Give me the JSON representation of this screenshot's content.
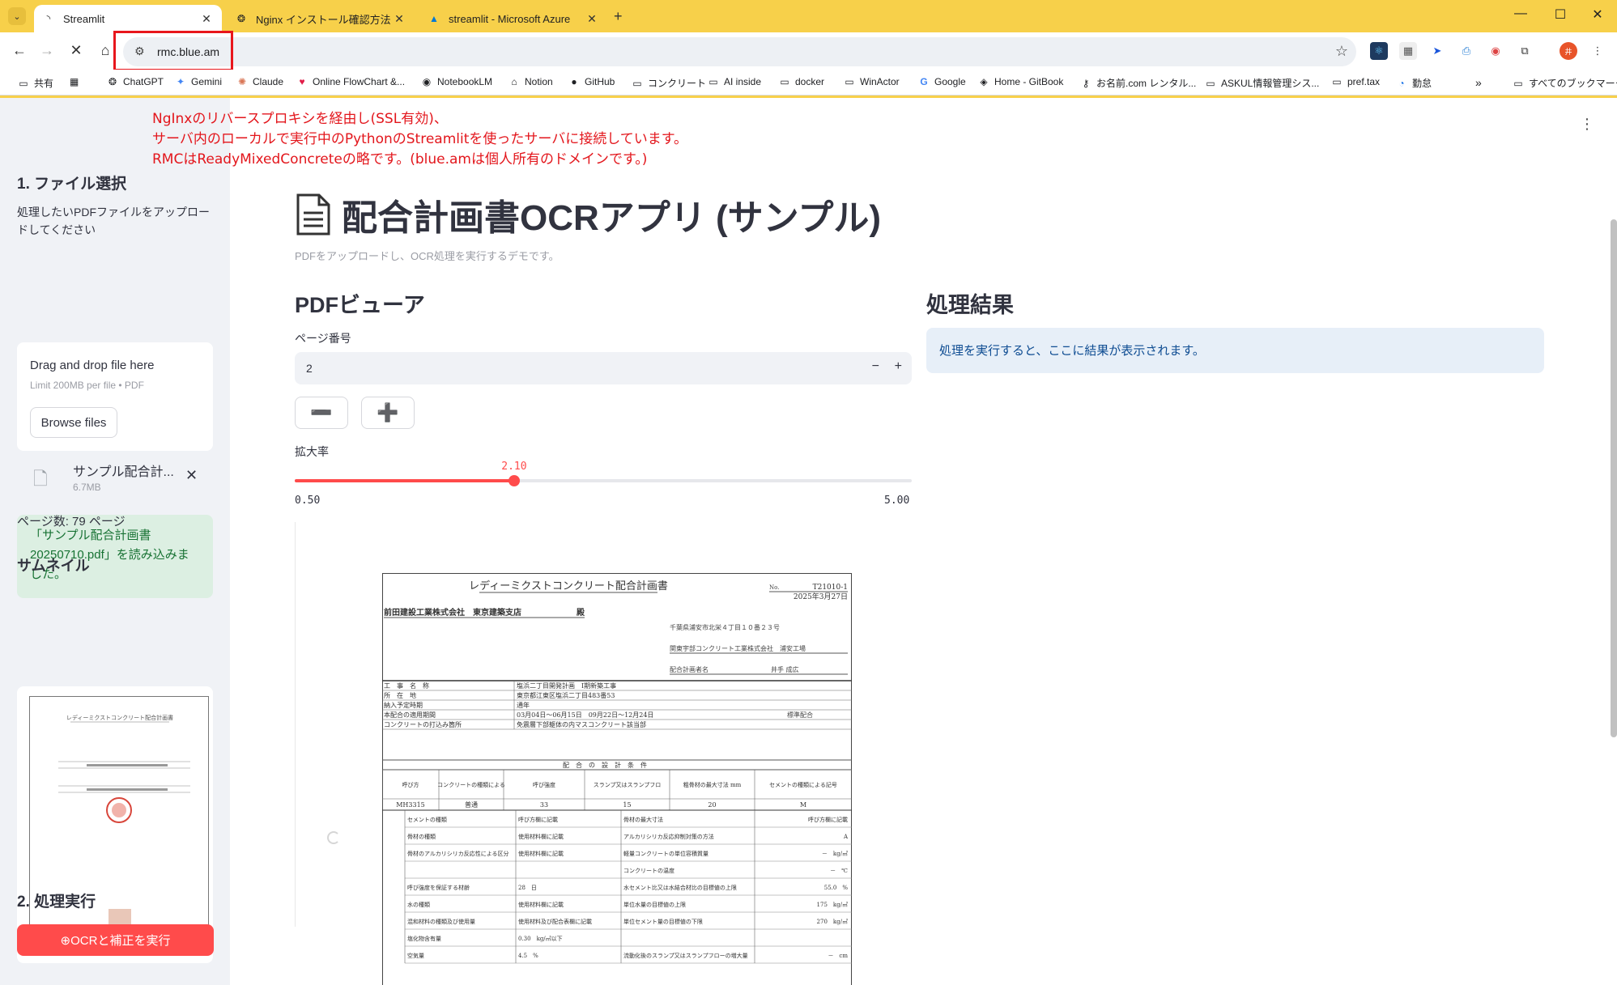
{
  "browser": {
    "tabs": [
      {
        "title": "Streamlit",
        "active": true
      },
      {
        "title": "Nginx インストール確認方法",
        "active": false
      },
      {
        "title": "streamlit - Microsoft Azure",
        "active": false
      }
    ],
    "url": "rmc.blue.am",
    "bookmarks": [
      "共有",
      "ChatGPT",
      "Gemini",
      "Claude",
      "Online FlowChart &...",
      "NotebookLM",
      "Notion",
      "GitHub",
      "コンクリート",
      "AI inside",
      "docker",
      "WinActor",
      "Google",
      "Home - GitBook",
      "お名前.com レンタル...",
      "ASKUL情報管理シス...",
      "pref.tax",
      "勤怠"
    ],
    "all_bookmarks": "すべてのブックマーク",
    "more": "»"
  },
  "annotation": [
    "NgInxのリバースプロキシを経由し(SSL有効)、",
    "サーバ内のローカルで実行中のPythonのStreamlitを使ったサーバに接続しています。",
    "RMCはReadyMixedConcreteの略です。(blue.amは個人所有のドメインです。)"
  ],
  "sidebar": {
    "section1_title": "1. ファイル選択",
    "upload_label": "処理したいPDFファイルをアップロードしてください",
    "dropzone_title": "Drag and drop file here",
    "dropzone_limit": "Limit 200MB per file • PDF",
    "browse_label": "Browse files",
    "file_name": "サンプル配合計...",
    "file_size": "6.7MB",
    "success_text": "「サンプル配合計画書20250710.pdf」を読み込みました。",
    "page_count": "ページ数: 79 ページ",
    "thumbnail_title": "サムネイル",
    "section2_title": "2. 処理実行",
    "run_label": "⊕OCRと補正を実行"
  },
  "main": {
    "title": "配合計画書OCRアプリ (サンプル)",
    "caption": "PDFをアップロードし、OCR処理を実行するデモです。",
    "viewer_title": "PDFビューア",
    "page_label": "ページ番号",
    "page_value": "2",
    "zoom_label": "拡大率",
    "zoom_value": "2.10",
    "zoom_min": "0.50",
    "zoom_max": "5.00",
    "zoom_min_num": 0.5,
    "zoom_max_num": 5.0,
    "zoom_num": 2.1,
    "result_title": "処理結果",
    "result_info": "処理を実行すると、ここに結果が表示されます。"
  },
  "document": {
    "title": "レディーミクストコンクリート配合計画書",
    "no_label": "No.",
    "no_value": "T21010-1",
    "date": "2025年3月27日",
    "recipient": "前田建設工業株式会社　東京建築支店",
    "recipient_suffix": "殿",
    "address": "千葉県浦安市北栄４丁目１０番２３号",
    "company": "関東宇部コンクリート工業株式会社　浦安工場",
    "planner_label": "配合計画者名",
    "planner_name": "井手 成広",
    "rows": [
      [
        "工　事　名　称",
        "塩浜二丁目開発計画　Ⅰ期新築工事"
      ],
      [
        "所　在　地",
        "東京都江東区塩浜二丁目483番53"
      ],
      [
        "納入予定時期",
        "通年"
      ],
      [
        "本配合の適用期間",
        "03月04日～06月15日　09月22日～12月24日"
      ],
      [
        "コンクリートの打込み箇所",
        "免震層下部躯体の内マスコンクリート該当部"
      ]
    ],
    "standard_label": "標準配合",
    "design_header": "配　合　の　設　計　条　件",
    "cond_headers": [
      "呼び方",
      "コンクリートの種類による記号",
      "呼び強度",
      "スランプ又はスランプフロー cm",
      "粗骨材の最大寸法 mm",
      "セメントの種類による記号"
    ],
    "cond_values": [
      "MH3315",
      "普通",
      "33",
      "15",
      "20",
      "M"
    ],
    "spec_rows": [
      [
        "セメントの種類",
        "呼び方欄に記載",
        "骨材の最大寸法",
        "呼び方欄に記載"
      ],
      [
        "骨材の種類",
        "使用材料欄に記載",
        "アルカリシリカ反応抑制対策の方法",
        "A"
      ],
      [
        "骨材のアルカリシリカ反応性による区分",
        "使用材料欄に記載",
        "軽量コンクリートの単位容積質量",
        "－　kg/㎥"
      ],
      [
        "",
        "",
        "コンクリートの温度",
        "－　℃"
      ],
      [
        "呼び強度を保証する材齢",
        "28　日",
        "水セメント比又は水結合材比の目標値の上限",
        "55.0　%"
      ],
      [
        "水の種類",
        "使用材料欄に記載",
        "単位水量の目標値の上限",
        "175　kg/㎥"
      ],
      [
        "混和材料の種類及び使用量",
        "使用材料及び配合表欄に記載",
        "単位セメント量の目標値の下限",
        "270　kg/㎥"
      ],
      [
        "塩化物含有量",
        "0.30　kg/㎥以下",
        "",
        ""
      ],
      [
        "空気量",
        "4.5　%",
        "流動化後のスランプ又はスランプフローの増大量",
        "－　cm"
      ]
    ]
  },
  "colors": {
    "accent": "#ff4b4b",
    "tabstrip": "#f7d04a",
    "annotation": "#e3161c",
    "success_bg": "#dcefe2",
    "info_bg": "#e7eff8"
  }
}
